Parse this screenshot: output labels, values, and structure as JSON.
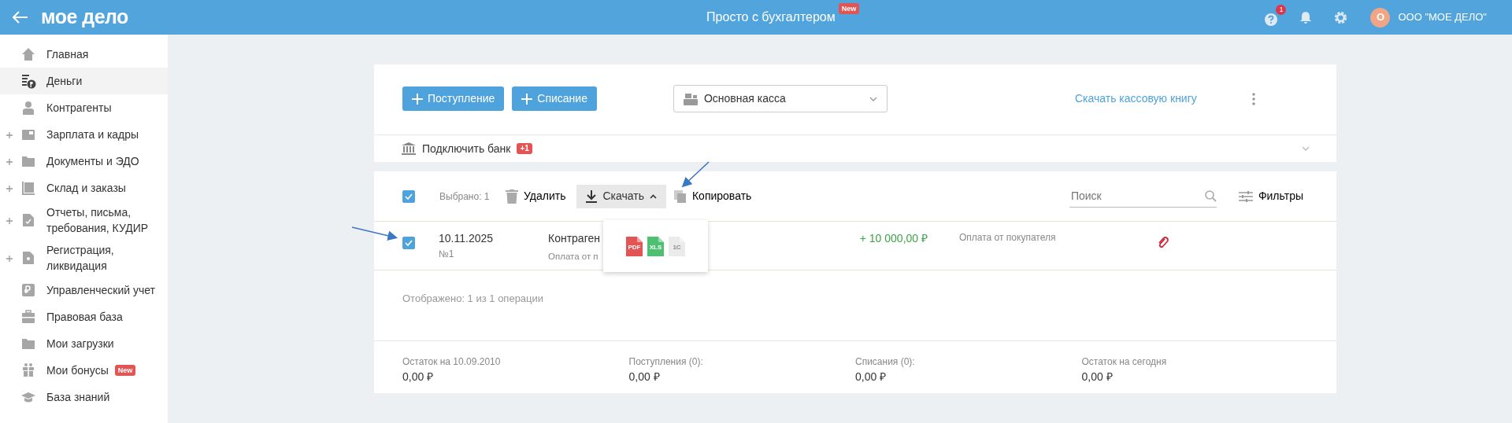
{
  "header": {
    "logo": "мое дело",
    "center_title": "Просто с бухгалтером",
    "center_badge": "New",
    "help_count": "1",
    "avatar_letter": "О",
    "organization": "ООО \"МОЕ ДЕЛО\""
  },
  "sidebar": {
    "items": [
      {
        "label": "Главная",
        "selected": false,
        "expandable": false
      },
      {
        "label": "Деньги",
        "selected": true,
        "expandable": false
      },
      {
        "label": "Контрагенты",
        "selected": false,
        "expandable": false
      },
      {
        "label": "Зарплата и кадры",
        "selected": false,
        "expandable": true
      },
      {
        "label": "Документы и ЭДО",
        "selected": false,
        "expandable": true
      },
      {
        "label": "Склад и заказы",
        "selected": false,
        "expandable": true
      },
      {
        "label": "Отчеты, письма, требования, КУДИР",
        "selected": false,
        "expandable": true
      },
      {
        "label": "Регистрация, ликвидация",
        "selected": false,
        "expandable": true
      },
      {
        "label": "Управленческий учет",
        "selected": false,
        "expandable": false
      },
      {
        "label": "Правовая база",
        "selected": false,
        "expandable": false
      },
      {
        "label": "Мои загрузки",
        "selected": false,
        "expandable": false
      },
      {
        "label": "Мои бонусы",
        "selected": false,
        "expandable": false,
        "badge": "New"
      },
      {
        "label": "База знаний",
        "selected": false,
        "expandable": false
      }
    ]
  },
  "actions": {
    "buttons": [
      "Поступление",
      "Списание"
    ],
    "cash_select": {
      "value": "Основная касса"
    },
    "download_link": "Скачать кассовую книгу"
  },
  "bank": {
    "label": "Подключить банк",
    "badge": "+1"
  },
  "toolbar": {
    "select_all_checked": true,
    "selected_count": "Выбрано: 1",
    "delete": "Удалить",
    "download": "Скачать",
    "copy": "Копировать",
    "search": {
      "placeholder": "Поиск"
    },
    "filters": "Фильтры"
  },
  "download_menu": {
    "items": [
      {
        "label": "PDF",
        "color": "#e35454",
        "disabled": false
      },
      {
        "label": "XLS",
        "color": "#4fbf72",
        "disabled": false
      },
      {
        "label": "1C",
        "color": "#ebebeb",
        "disabled": true
      }
    ]
  },
  "operations": [
    {
      "checked": true,
      "date": "10.11.2025",
      "number": "№1",
      "counterparty": "Контраген",
      "purpose": "Оплата от п",
      "amount": "+ 10 000,00 ₽",
      "type": "Оплата от покупателя",
      "has_attachment": true
    }
  ],
  "shown_count": "Отображено: 1 из 1 операции",
  "totals": [
    {
      "label": "Остаток на 10.09.2010",
      "value": "0,00 ₽"
    },
    {
      "label": "Поступления (0):",
      "value": "0,00 ₽"
    },
    {
      "label": "Списания (0):",
      "value": "0,00 ₽"
    },
    {
      "label": "Остаток на сегодня",
      "value": "0,00 ₽"
    }
  ]
}
